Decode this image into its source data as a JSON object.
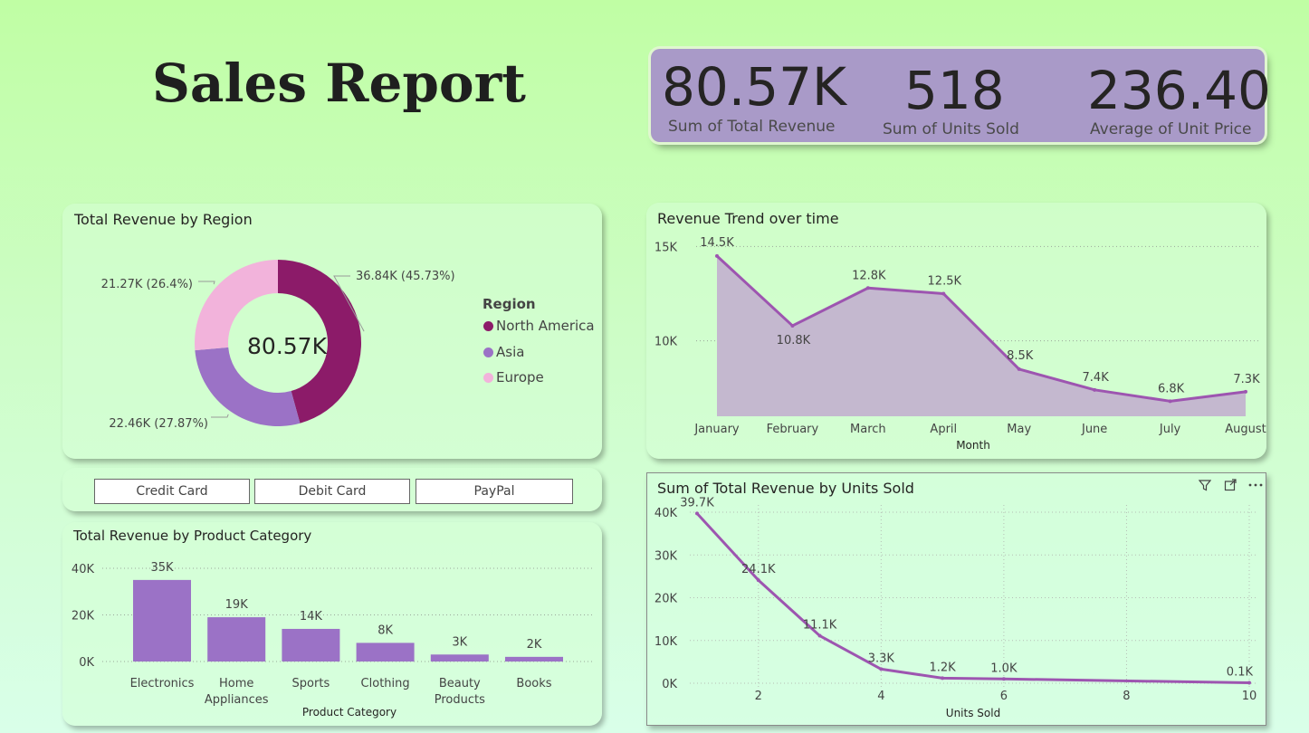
{
  "title": "Sales Report",
  "colors": {
    "purple": "#9b72c6",
    "line": "#9d55b0",
    "area": "#c4b8cf",
    "north_america": "#8c1b69",
    "asia": "#9b72c6",
    "europe": "#f2b3db",
    "kpi_band": "#a99ac8"
  },
  "kpis": [
    {
      "value": "80.57K",
      "label": "Sum of Total Revenue"
    },
    {
      "value": "518",
      "label": "Sum of Units Sold"
    },
    {
      "value": "236.40",
      "label": "Average of Unit Price"
    }
  ],
  "slicer": {
    "options": [
      "Credit Card",
      "Debit Card",
      "PayPal"
    ]
  },
  "visual_header_icons": [
    "filter-icon",
    "focus-mode-icon",
    "more-options-icon"
  ],
  "chart_data": [
    {
      "id": "region",
      "type": "pie",
      "title": "Total Revenue by Region",
      "center_label": "80.57K",
      "legend_title": "Region",
      "legend_position": "right",
      "categories": [
        "North America",
        "Asia",
        "Europe"
      ],
      "values": [
        36.84,
        22.46,
        21.27
      ],
      "labels": [
        "36.84K (45.73%)",
        "22.46K (27.87%)",
        "21.27K (26.4%)"
      ]
    },
    {
      "id": "trend",
      "type": "area",
      "title": "Revenue Trend over time",
      "xlabel": "Month",
      "ylabel": "",
      "categories": [
        "January",
        "February",
        "March",
        "April",
        "May",
        "June",
        "July",
        "August"
      ],
      "values": [
        14.5,
        10.8,
        12.8,
        12.5,
        8.5,
        7.4,
        6.8,
        7.3
      ],
      "labels": [
        "14.5K",
        "10.8K",
        "12.8K",
        "12.5K",
        "8.5K",
        "7.4K",
        "6.8K",
        "7.3K"
      ],
      "yticks": [
        "10K",
        "15K"
      ],
      "ytick_values": [
        10,
        15
      ],
      "ylim": [
        6,
        15.5
      ],
      "grid": true
    },
    {
      "id": "category",
      "type": "bar",
      "title": "Total Revenue by Product Category",
      "xlabel": "Product Category",
      "ylabel": "",
      "categories": [
        "Electronics",
        "Home Appliances",
        "Sports",
        "Clothing",
        "Beauty Products",
        "Books"
      ],
      "values": [
        35,
        19,
        14,
        8,
        3,
        2
      ],
      "labels": [
        "35K",
        "19K",
        "14K",
        "8K",
        "3K",
        "2K"
      ],
      "yticks": [
        "0K",
        "20K",
        "40K"
      ],
      "ytick_values": [
        0,
        20,
        40
      ],
      "ylim": [
        0,
        40
      ],
      "grid": true
    },
    {
      "id": "units",
      "type": "line",
      "title": "Sum of Total Revenue by Units Sold",
      "xlabel": "Units Sold",
      "ylabel": "",
      "x": [
        1,
        2,
        3,
        4,
        5,
        6,
        10
      ],
      "values": [
        39.7,
        24.1,
        11.1,
        3.3,
        1.2,
        1.0,
        0.1
      ],
      "labels": [
        "39.7K",
        "24.1K",
        "11.1K",
        "3.3K",
        "1.2K",
        "1.0K",
        "0.1K"
      ],
      "xticks": [
        "2",
        "4",
        "6",
        "8",
        "10"
      ],
      "xtick_values": [
        2,
        4,
        6,
        8,
        10
      ],
      "yticks": [
        "0K",
        "10K",
        "20K",
        "30K",
        "40K"
      ],
      "ytick_values": [
        0,
        10,
        20,
        30,
        40
      ],
      "xlim": [
        1,
        10
      ],
      "ylim": [
        0,
        40
      ],
      "grid": true
    }
  ]
}
